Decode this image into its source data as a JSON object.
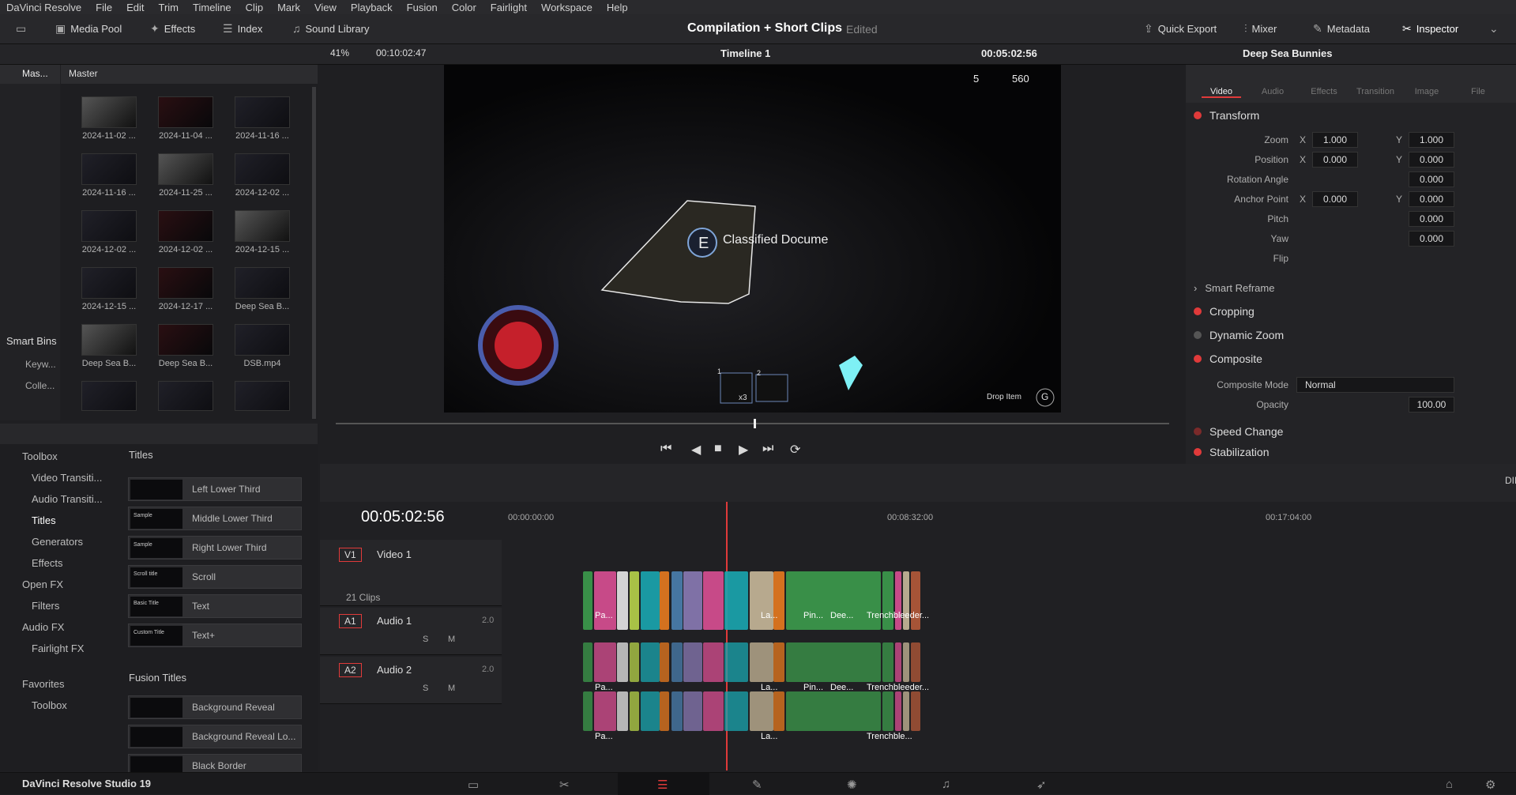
{
  "menubar": {
    "app": "DaVinci Resolve",
    "items": [
      "File",
      "Edit",
      "Trim",
      "Timeline",
      "Clip",
      "Mark",
      "View",
      "Playback",
      "Fusion",
      "Color",
      "Fairlight",
      "Workspace",
      "Help"
    ]
  },
  "toolbar": {
    "media_pool": "Media Pool",
    "effects": "Effects",
    "index": "Index",
    "sound_library": "Sound Library",
    "project_title": "Compilation + Short Clips",
    "edited": "Edited",
    "quick_export": "Quick Export",
    "mixer": "Mixer",
    "metadata": "Metadata",
    "inspector": "Inspector"
  },
  "subbar": {
    "zoom": "41%",
    "source_tc": "00:10:02:47",
    "timeline_name": "Timeline 1",
    "record_tc": "00:05:02:56",
    "inspector_clip": "Deep Sea Bunnies"
  },
  "mediapool": {
    "bins_header": "Mas...",
    "master": "Master",
    "smart_bins": "Smart Bins",
    "bin_items": [
      "Keyw...",
      "Colle..."
    ],
    "clips": [
      "2024-11-02 ...",
      "2024-11-04 ...",
      "2024-11-16 ...",
      "2024-11-16 ...",
      "2024-11-25 ...",
      "2024-12-02 ...",
      "2024-12-02 ...",
      "2024-12-02 ...",
      "2024-12-15 ...",
      "2024-12-15 ...",
      "2024-12-17 ...",
      "Deep Sea B...",
      "Deep Sea B...",
      "Deep Sea B...",
      "DSB.mp4"
    ]
  },
  "effects_panel": {
    "tree": [
      "Toolbox",
      "Video Transiti...",
      "Audio Transiti...",
      "Titles",
      "Generators",
      "Effects",
      "Open FX",
      "Filters",
      "Audio FX",
      "Fairlight FX",
      "Favorites",
      "Toolbox"
    ],
    "titles_header": "Titles",
    "titles": [
      "Left Lower Third",
      "Middle Lower Third",
      "Right Lower Third",
      "Scroll",
      "Text",
      "Text+"
    ],
    "title_thumbs": [
      "",
      "Sample",
      "Sample",
      "Scroll title",
      "Basic Title",
      "Custom Title"
    ],
    "fusion_header": "Fusion Titles",
    "fusion_titles": [
      "Background Reveal",
      "Background Reveal Lo...",
      "Black Border"
    ]
  },
  "viewer": {
    "hud_count": "5",
    "hud_money": "560",
    "prompt_key": "E",
    "prompt_text": "Classified Docume",
    "inv_slot1": "1",
    "inv_slot2": "2",
    "inv_qty": "x3",
    "drop_item": "Drop Item",
    "drop_key": "G"
  },
  "inspector": {
    "tabs": [
      "Video",
      "Audio",
      "Effects",
      "Transition",
      "Image",
      "File"
    ],
    "transform": "Transform",
    "zoom_label": "Zoom",
    "zoom_x": "1.000",
    "zoom_y": "1.000",
    "position_label": "Position",
    "pos_x": "0.000",
    "pos_y": "0.000",
    "rotation_label": "Rotation Angle",
    "rotation": "0.000",
    "anchor_label": "Anchor Point",
    "anchor_x": "0.000",
    "anchor_y": "0.000",
    "pitch_label": "Pitch",
    "pitch": "0.000",
    "yaw_label": "Yaw",
    "yaw": "0.000",
    "flip_label": "Flip",
    "x": "X",
    "y": "Y",
    "smart_reframe": "Smart Reframe",
    "cropping": "Cropping",
    "dynamic_zoom": "Dynamic Zoom",
    "composite": "Composite",
    "composite_mode_label": "Composite Mode",
    "composite_mode": "Normal",
    "opacity_label": "Opacity",
    "opacity": "100.00",
    "speed_change": "Speed Change",
    "stabilization": "Stabilization"
  },
  "timeline": {
    "timecode": "00:05:02:56",
    "ruler": [
      "00:00:00:00",
      "00:08:32:00",
      "00:17:04:00"
    ],
    "v1": "V1",
    "video1": "Video 1",
    "clips_count": "21 Clips",
    "a1": "A1",
    "audio1": "Audio 1",
    "a1_ch": "2.0",
    "a2": "A2",
    "audio2": "Audio 2",
    "a2_ch": "2.0",
    "s": "S",
    "m": "M",
    "dim": "DIM",
    "clip_labels": [
      "Pa...",
      "La...",
      "Pin...",
      "Dee...",
      "Trenchbleeder...",
      "Trenchble..."
    ]
  },
  "bottombar": {
    "app_name": "DaVinci Resolve Studio 19"
  },
  "colors": {
    "accent_red": "#e03a3a",
    "teal": "#1aa6b0",
    "pink": "#d94f93",
    "green": "#3c9b4c"
  }
}
